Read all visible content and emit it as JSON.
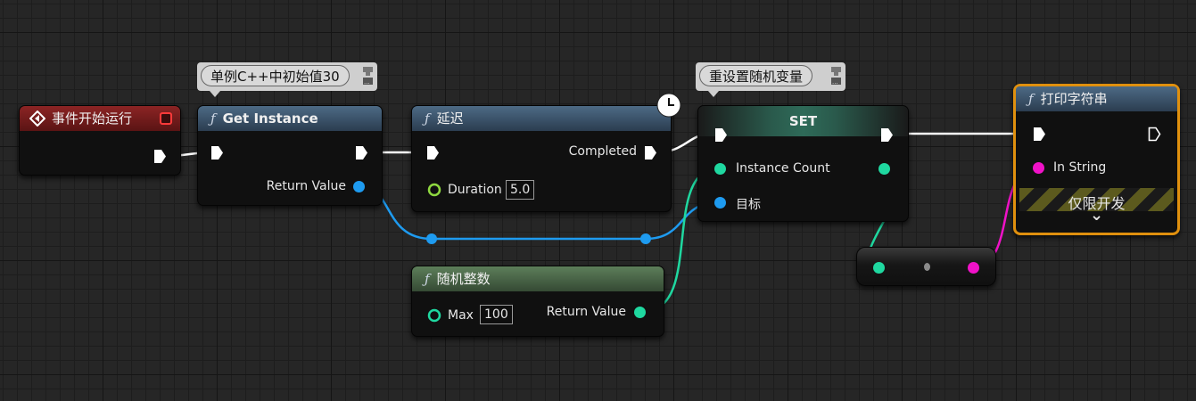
{
  "colors": {
    "exec": "#ffffff",
    "object": "#1e9bf0",
    "integer": "#1fd8a0",
    "string": "#f012c8",
    "float": "#8fd840",
    "dev_only_border": "#e0900e"
  },
  "comments": {
    "singleton": "单例C++中初始值30",
    "reset_random": "重设置随机变量"
  },
  "nodes": {
    "begin_play": {
      "title": "事件开始运行"
    },
    "get_instance": {
      "title": "Get Instance",
      "return_label": "Return Value"
    },
    "delay": {
      "title": "延迟",
      "completed_label": "Completed",
      "duration_label": "Duration",
      "duration_value": "5.0"
    },
    "set": {
      "title": "SET",
      "instance_count_label": "Instance Count",
      "target_label": "目标"
    },
    "random_int": {
      "title": "随机整数",
      "max_label": "Max",
      "max_value": "100",
      "return_label": "Return Value"
    },
    "print_string": {
      "title": "打印字符串",
      "in_string_label": "In String",
      "dev_only_label": "仅限开发",
      "expand_glyph": "⌄"
    }
  },
  "icons": {
    "event": "event-diamond-icon",
    "function": "function-icon",
    "latent": "clock-icon",
    "delegate": "delegate-square-icon"
  }
}
